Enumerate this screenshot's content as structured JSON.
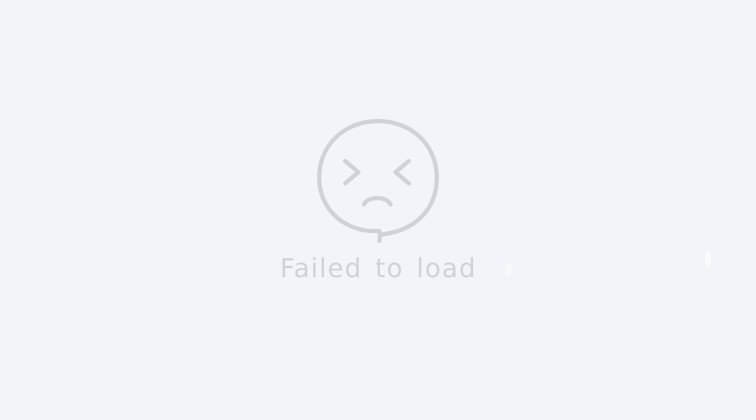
{
  "empty_state": {
    "icon": "sad-face-speech-bubble-icon",
    "message": "Failed to load"
  },
  "colors": {
    "background": "#f1f4f8",
    "icon": "#cfd2d6",
    "message_text": "#cfd2d6"
  }
}
